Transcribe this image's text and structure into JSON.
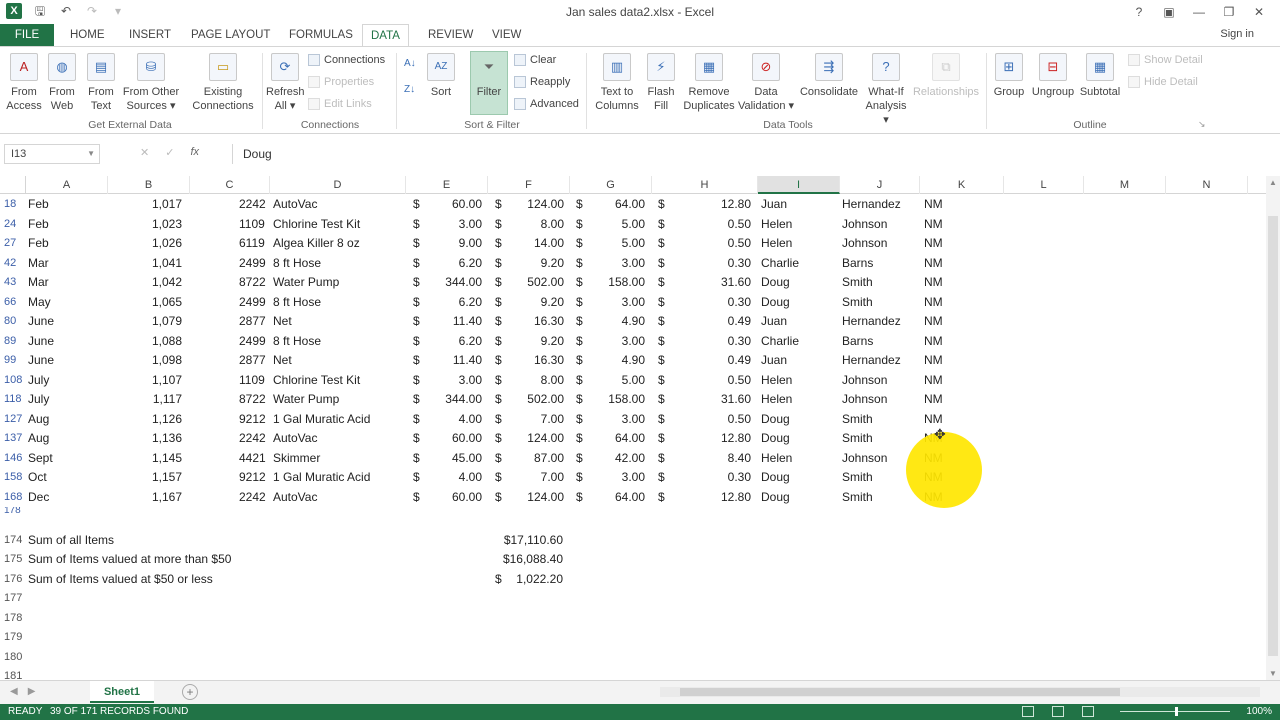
{
  "window": {
    "title": "Jan sales data2.xlsx - Excel",
    "app_icon": "X",
    "signin": "Sign in"
  },
  "tabs": [
    "FILE",
    "HOME",
    "INSERT",
    "PAGE LAYOUT",
    "FORMULAS",
    "DATA",
    "REVIEW",
    "VIEW"
  ],
  "active_tab": "DATA",
  "ribbon": {
    "get_external": {
      "label": "Get External Data",
      "buttons": [
        {
          "l1": "From",
          "l2": "Access",
          "icon": "access-icon"
        },
        {
          "l1": "From",
          "l2": "Web",
          "icon": "web-icon"
        },
        {
          "l1": "From",
          "l2": "Text",
          "icon": "text-file-icon"
        },
        {
          "l1": "From Other",
          "l2": "Sources ▾",
          "icon": "database-icon"
        },
        {
          "l1": "Existing",
          "l2": "Connections",
          "icon": "connections-icon"
        }
      ]
    },
    "connections": {
      "label": "Connections",
      "refresh_l1": "Refresh",
      "refresh_l2": "All ▾",
      "connections": "Connections",
      "properties": "Properties",
      "edit_links": "Edit Links"
    },
    "sort_filter": {
      "label": "Sort & Filter",
      "sort": "Sort",
      "filter": "Filter",
      "clear": "Clear",
      "reapply": "Reapply",
      "advanced": "Advanced"
    },
    "data_tools": {
      "label": "Data Tools",
      "buttons": [
        {
          "l1": "Text to",
          "l2": "Columns"
        },
        {
          "l1": "Flash",
          "l2": "Fill"
        },
        {
          "l1": "Remove",
          "l2": "Duplicates"
        },
        {
          "l1": "Data",
          "l2": "Validation ▾"
        },
        {
          "l1": "Consolidate",
          "l2": ""
        },
        {
          "l1": "What-If",
          "l2": "Analysis ▾"
        },
        {
          "l1": "Relationships",
          "l2": ""
        }
      ]
    },
    "outline": {
      "label": "Outline",
      "group": "Group",
      "ungroup": "Ungroup",
      "subtotal": "Subtotal",
      "show_detail": "Show Detail",
      "hide_detail": "Hide Detail"
    }
  },
  "formula_bar": {
    "name_box": "I13",
    "fx": "fx",
    "value": "Doug"
  },
  "columns": [
    "A",
    "B",
    "C",
    "D",
    "E",
    "F",
    "G",
    "H",
    "I",
    "J",
    "K",
    "L",
    "M",
    "N"
  ],
  "selected_column": "I",
  "rows": [
    {
      "n": "18",
      "a": "Feb",
      "b": "1,017",
      "c": "2242",
      "d": "AutoVac",
      "e": "60.00",
      "f": "124.00",
      "g": "64.00",
      "h": "12.80",
      "i": "Juan",
      "j": "Hernandez",
      "k": "NM"
    },
    {
      "n": "24",
      "a": "Feb",
      "b": "1,023",
      "c": "1109",
      "d": "Chlorine Test Kit",
      "e": "3.00",
      "f": "8.00",
      "g": "5.00",
      "h": "0.50",
      "i": "Helen",
      "j": "Johnson",
      "k": "NM"
    },
    {
      "n": "27",
      "a": "Feb",
      "b": "1,026",
      "c": "6119",
      "d": "Algea Killer 8 oz",
      "e": "9.00",
      "f": "14.00",
      "g": "5.00",
      "h": "0.50",
      "i": "Helen",
      "j": "Johnson",
      "k": "NM"
    },
    {
      "n": "42",
      "a": "Mar",
      "b": "1,041",
      "c": "2499",
      "d": "8 ft Hose",
      "e": "6.20",
      "f": "9.20",
      "g": "3.00",
      "h": "0.30",
      "i": "Charlie",
      "j": "Barns",
      "k": "NM"
    },
    {
      "n": "43",
      "a": "Mar",
      "b": "1,042",
      "c": "8722",
      "d": "Water Pump",
      "e": "344.00",
      "f": "502.00",
      "g": "158.00",
      "h": "31.60",
      "i": "Doug",
      "j": "Smith",
      "k": "NM"
    },
    {
      "n": "66",
      "a": "May",
      "b": "1,065",
      "c": "2499",
      "d": "8 ft Hose",
      "e": "6.20",
      "f": "9.20",
      "g": "3.00",
      "h": "0.30",
      "i": "Doug",
      "j": "Smith",
      "k": "NM"
    },
    {
      "n": "80",
      "a": "June",
      "b": "1,079",
      "c": "2877",
      "d": "Net",
      "e": "11.40",
      "f": "16.30",
      "g": "4.90",
      "h": "0.49",
      "i": "Juan",
      "j": "Hernandez",
      "k": "NM"
    },
    {
      "n": "89",
      "a": "June",
      "b": "1,088",
      "c": "2499",
      "d": "8 ft Hose",
      "e": "6.20",
      "f": "9.20",
      "g": "3.00",
      "h": "0.30",
      "i": "Charlie",
      "j": "Barns",
      "k": "NM"
    },
    {
      "n": "99",
      "a": "June",
      "b": "1,098",
      "c": "2877",
      "d": "Net",
      "e": "11.40",
      "f": "16.30",
      "g": "4.90",
      "h": "0.49",
      "i": "Juan",
      "j": "Hernandez",
      "k": "NM"
    },
    {
      "n": "108",
      "a": "July",
      "b": "1,107",
      "c": "1109",
      "d": "Chlorine Test Kit",
      "e": "3.00",
      "f": "8.00",
      "g": "5.00",
      "h": "0.50",
      "i": "Helen",
      "j": "Johnson",
      "k": "NM"
    },
    {
      "n": "118",
      "a": "July",
      "b": "1,117",
      "c": "8722",
      "d": "Water Pump",
      "e": "344.00",
      "f": "502.00",
      "g": "158.00",
      "h": "31.60",
      "i": "Helen",
      "j": "Johnson",
      "k": "NM"
    },
    {
      "n": "127",
      "a": "Aug",
      "b": "1,126",
      "c": "9212",
      "d": "1 Gal Muratic Acid",
      "e": "4.00",
      "f": "7.00",
      "g": "3.00",
      "h": "0.50",
      "i": "Doug",
      "j": "Smith",
      "k": "NM"
    },
    {
      "n": "137",
      "a": "Aug",
      "b": "1,136",
      "c": "2242",
      "d": "AutoVac",
      "e": "60.00",
      "f": "124.00",
      "g": "64.00",
      "h": "12.80",
      "i": "Doug",
      "j": "Smith",
      "k": "NM"
    },
    {
      "n": "146",
      "a": "Sept",
      "b": "1,145",
      "c": "4421",
      "d": "Skimmer",
      "e": "45.00",
      "f": "87.00",
      "g": "42.00",
      "h": "8.40",
      "i": "Helen",
      "j": "Johnson",
      "k": "NM"
    },
    {
      "n": "158",
      "a": "Oct",
      "b": "1,157",
      "c": "9212",
      "d": "1 Gal Muratic Acid",
      "e": "4.00",
      "f": "7.00",
      "g": "3.00",
      "h": "0.30",
      "i": "Doug",
      "j": "Smith",
      "k": "NM"
    },
    {
      "n": "168",
      "a": "Dec",
      "b": "1,167",
      "c": "2242",
      "d": "AutoVac",
      "e": "60.00",
      "f": "124.00",
      "g": "64.00",
      "h": "12.80",
      "i": "Doug",
      "j": "Smith",
      "k": "NM"
    }
  ],
  "currency_symbol": "$",
  "partial_row": "178",
  "summary_rows": [
    {
      "n": "174",
      "label": "Sum of all Items",
      "dollar": "",
      "value": "$17,110.60"
    },
    {
      "n": "175",
      "label": "Sum of Items valued at more than $50",
      "dollar": "",
      "value": "$16,088.40"
    },
    {
      "n": "176",
      "label": "Sum of Items valued at $50 or less",
      "dollar": "$",
      "value": "1,022.20"
    }
  ],
  "empty_rows": [
    "177",
    "178",
    "179",
    "180",
    "181"
  ],
  "sheet_tab": "Sheet1",
  "status": {
    "ready": "READY",
    "records": "39 OF 171 RECORDS FOUND",
    "zoom": "100%"
  },
  "colors": {
    "excel_green": "#217346",
    "highlight": "#ffe600",
    "row_number_blue": "#3b5ea8"
  }
}
